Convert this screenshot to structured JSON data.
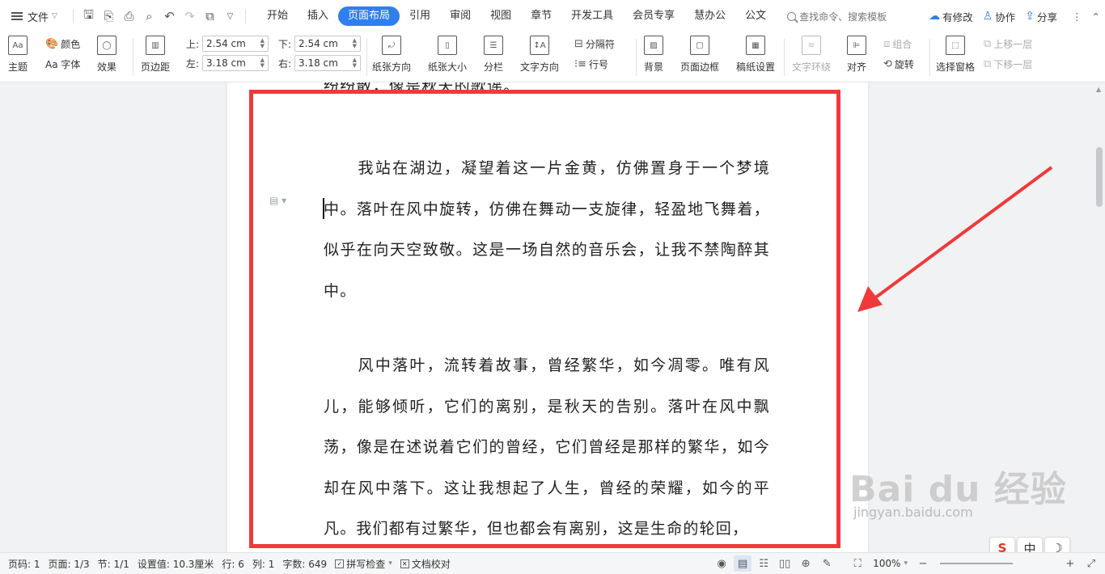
{
  "topbar": {
    "menu_label": "文件",
    "tabs": [
      "开始",
      "插入",
      "页面布局",
      "引用",
      "审阅",
      "视图",
      "章节",
      "开发工具",
      "会员专享",
      "慧办公",
      "公文"
    ],
    "active_tab": "页面布局",
    "search_placeholder": "查找命令、搜索模板",
    "actions": {
      "modify": "有修改",
      "collab": "协作",
      "share": "分享"
    }
  },
  "ribbon": {
    "theme": "主题",
    "color": "颜色",
    "font": "Aa 字体",
    "effect": "效果",
    "margins": "页边距",
    "margin_top_label": "上:",
    "margin_top": "2.54 cm",
    "margin_bottom_label": "下:",
    "margin_bottom": "2.54 cm",
    "margin_left_label": "左:",
    "margin_left": "3.18 cm",
    "margin_right_label": "右:",
    "margin_right": "3.18 cm",
    "orientation": "纸张方向",
    "size": "纸张大小",
    "columns": "分栏",
    "text_direction": "文字方向",
    "breaks": "分隔符",
    "line_numbers": "行号",
    "background": "背景",
    "page_border": "页面边框",
    "manuscript": "稿纸设置",
    "wrap_text": "文字环绕",
    "align": "对齐",
    "group": "组合",
    "rotate": "旋转",
    "select_pane": "选择窗格",
    "bring_forward": "上移一层",
    "send_backward": "下移一层"
  },
  "document": {
    "top_line": "纷纷散，像是秋天的歌谣。",
    "paragraph1": "　　我站在湖边，凝望着这一片金黄，仿佛置身于一个梦境中。落叶在风中旋转，仿佛在舞动一支旋律，轻盈地飞舞着，似乎在向天空致敬。这是一场自然的音乐会，让我不禁陶醉其中。",
    "paragraph2": "　　风中落叶，流转着故事，曾经繁华，如今凋零。唯有风儿，能够倾听，它们的离别，是秋天的告别。落叶在风中飘荡，像是在述说着它们的曾经，它们曾经是那样的繁华，如今却在风中落下。这让我想起了人生，曾经的荣耀，如今的平凡。我们都有过繁华，但也都会有离别，这是生命的轮回，"
  },
  "watermark": {
    "main": "Bai du 经验",
    "sub": "jingyan.baidu.com"
  },
  "ime": {
    "logo": "S",
    "lang": "中",
    "moon": "☽"
  },
  "statusbar": {
    "page_num": "页码: 1",
    "pages": "页面: 1/3",
    "section": "节: 1/1",
    "setting": "设置值: 10.3厘米",
    "row": "行: 6",
    "col": "列: 1",
    "words": "字数: 649",
    "spellcheck": "拼写检查",
    "proofread": "文档校对",
    "zoom": "100%"
  },
  "colors": {
    "accent": "#2f7ff0",
    "highlight": "#ef3a3a"
  }
}
